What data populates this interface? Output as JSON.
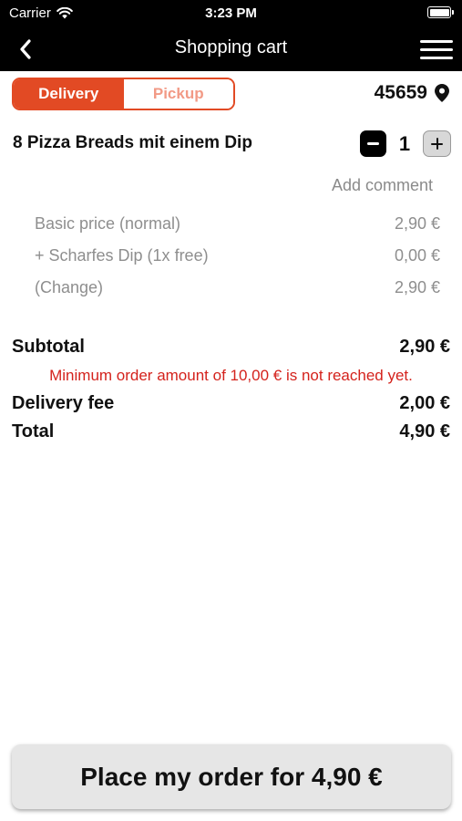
{
  "status_bar": {
    "carrier": "Carrier",
    "time": "3:23 PM"
  },
  "nav": {
    "title": "Shopping cart",
    "back_icon": "chevron-left-icon",
    "menu_icon": "hamburger-menu-icon"
  },
  "order_type": {
    "options": [
      "Delivery",
      "Pickup"
    ],
    "selected": "Delivery",
    "accent_color": "#e24a24"
  },
  "location": {
    "postal_code": "45659",
    "icon": "location-pin-icon"
  },
  "cart_item": {
    "name": "8 Pizza Breads mit einem Dip",
    "quantity": "1",
    "add_comment_label": "Add comment",
    "price_lines": [
      {
        "label": "Basic price (normal)",
        "value": "2,90 €"
      },
      {
        "label": "+ Scharfes Dip (1x free)",
        "value": "0,00 €"
      },
      {
        "label": "(Change)",
        "value": "2,90 €"
      }
    ]
  },
  "summary": {
    "subtotal_label": "Subtotal",
    "subtotal_value": "2,90 €",
    "warning": "Minimum order amount of 10,00 € is not reached yet.",
    "delivery_fee_label": "Delivery fee",
    "delivery_fee_value": "2,00 €",
    "total_label": "Total",
    "total_value": "4,90 €"
  },
  "place_order_label": "Place my order for 4,90 €"
}
